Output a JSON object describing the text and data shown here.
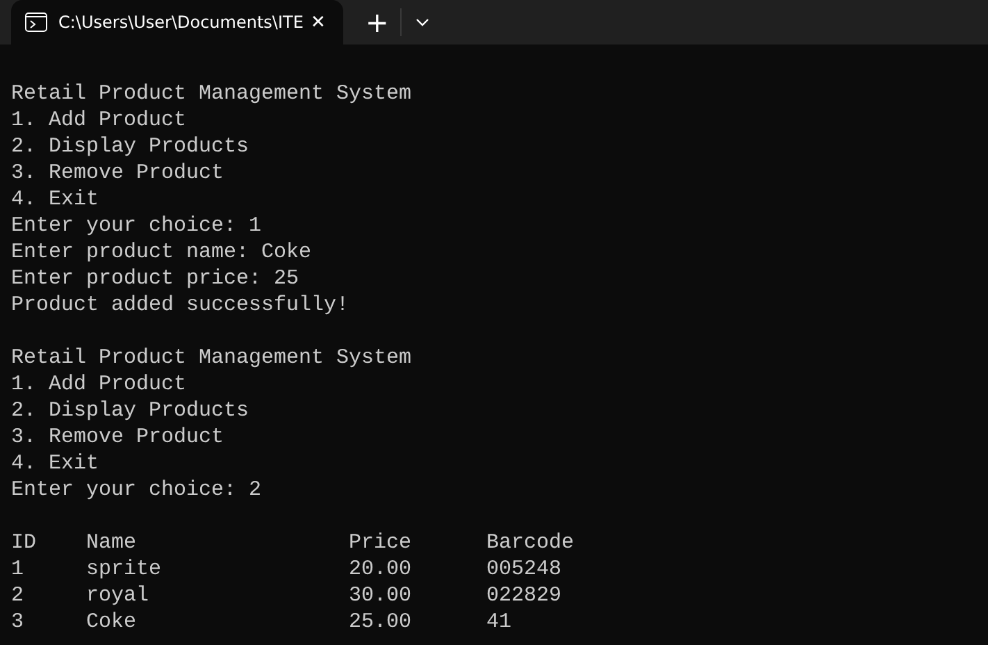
{
  "window": {
    "tab_title": "C:\\Users\\User\\Documents\\ITE",
    "close_glyph": "✕",
    "new_tab_glyph": "+"
  },
  "terminal": {
    "blocks": [
      {
        "lines": [
          "Retail Product Management System",
          "1. Add Product",
          "2. Display Products",
          "3. Remove Product",
          "4. Exit",
          "Enter your choice: 1",
          "Enter product name: Coke",
          "Enter product price: 25",
          "Product added successfully!"
        ]
      },
      {
        "lines": [
          "Retail Product Management System",
          "1. Add Product",
          "2. Display Products",
          "3. Remove Product",
          "4. Exit",
          "Enter your choice: 2"
        ]
      }
    ],
    "table": {
      "columns": [
        "ID",
        "Name",
        "Price",
        "Barcode"
      ],
      "rows": [
        [
          "1",
          "sprite",
          "20.00",
          "005248"
        ],
        [
          "2",
          "royal",
          "30.00",
          "022829"
        ],
        [
          "3",
          "Coke",
          "25.00",
          "41"
        ]
      ]
    }
  }
}
